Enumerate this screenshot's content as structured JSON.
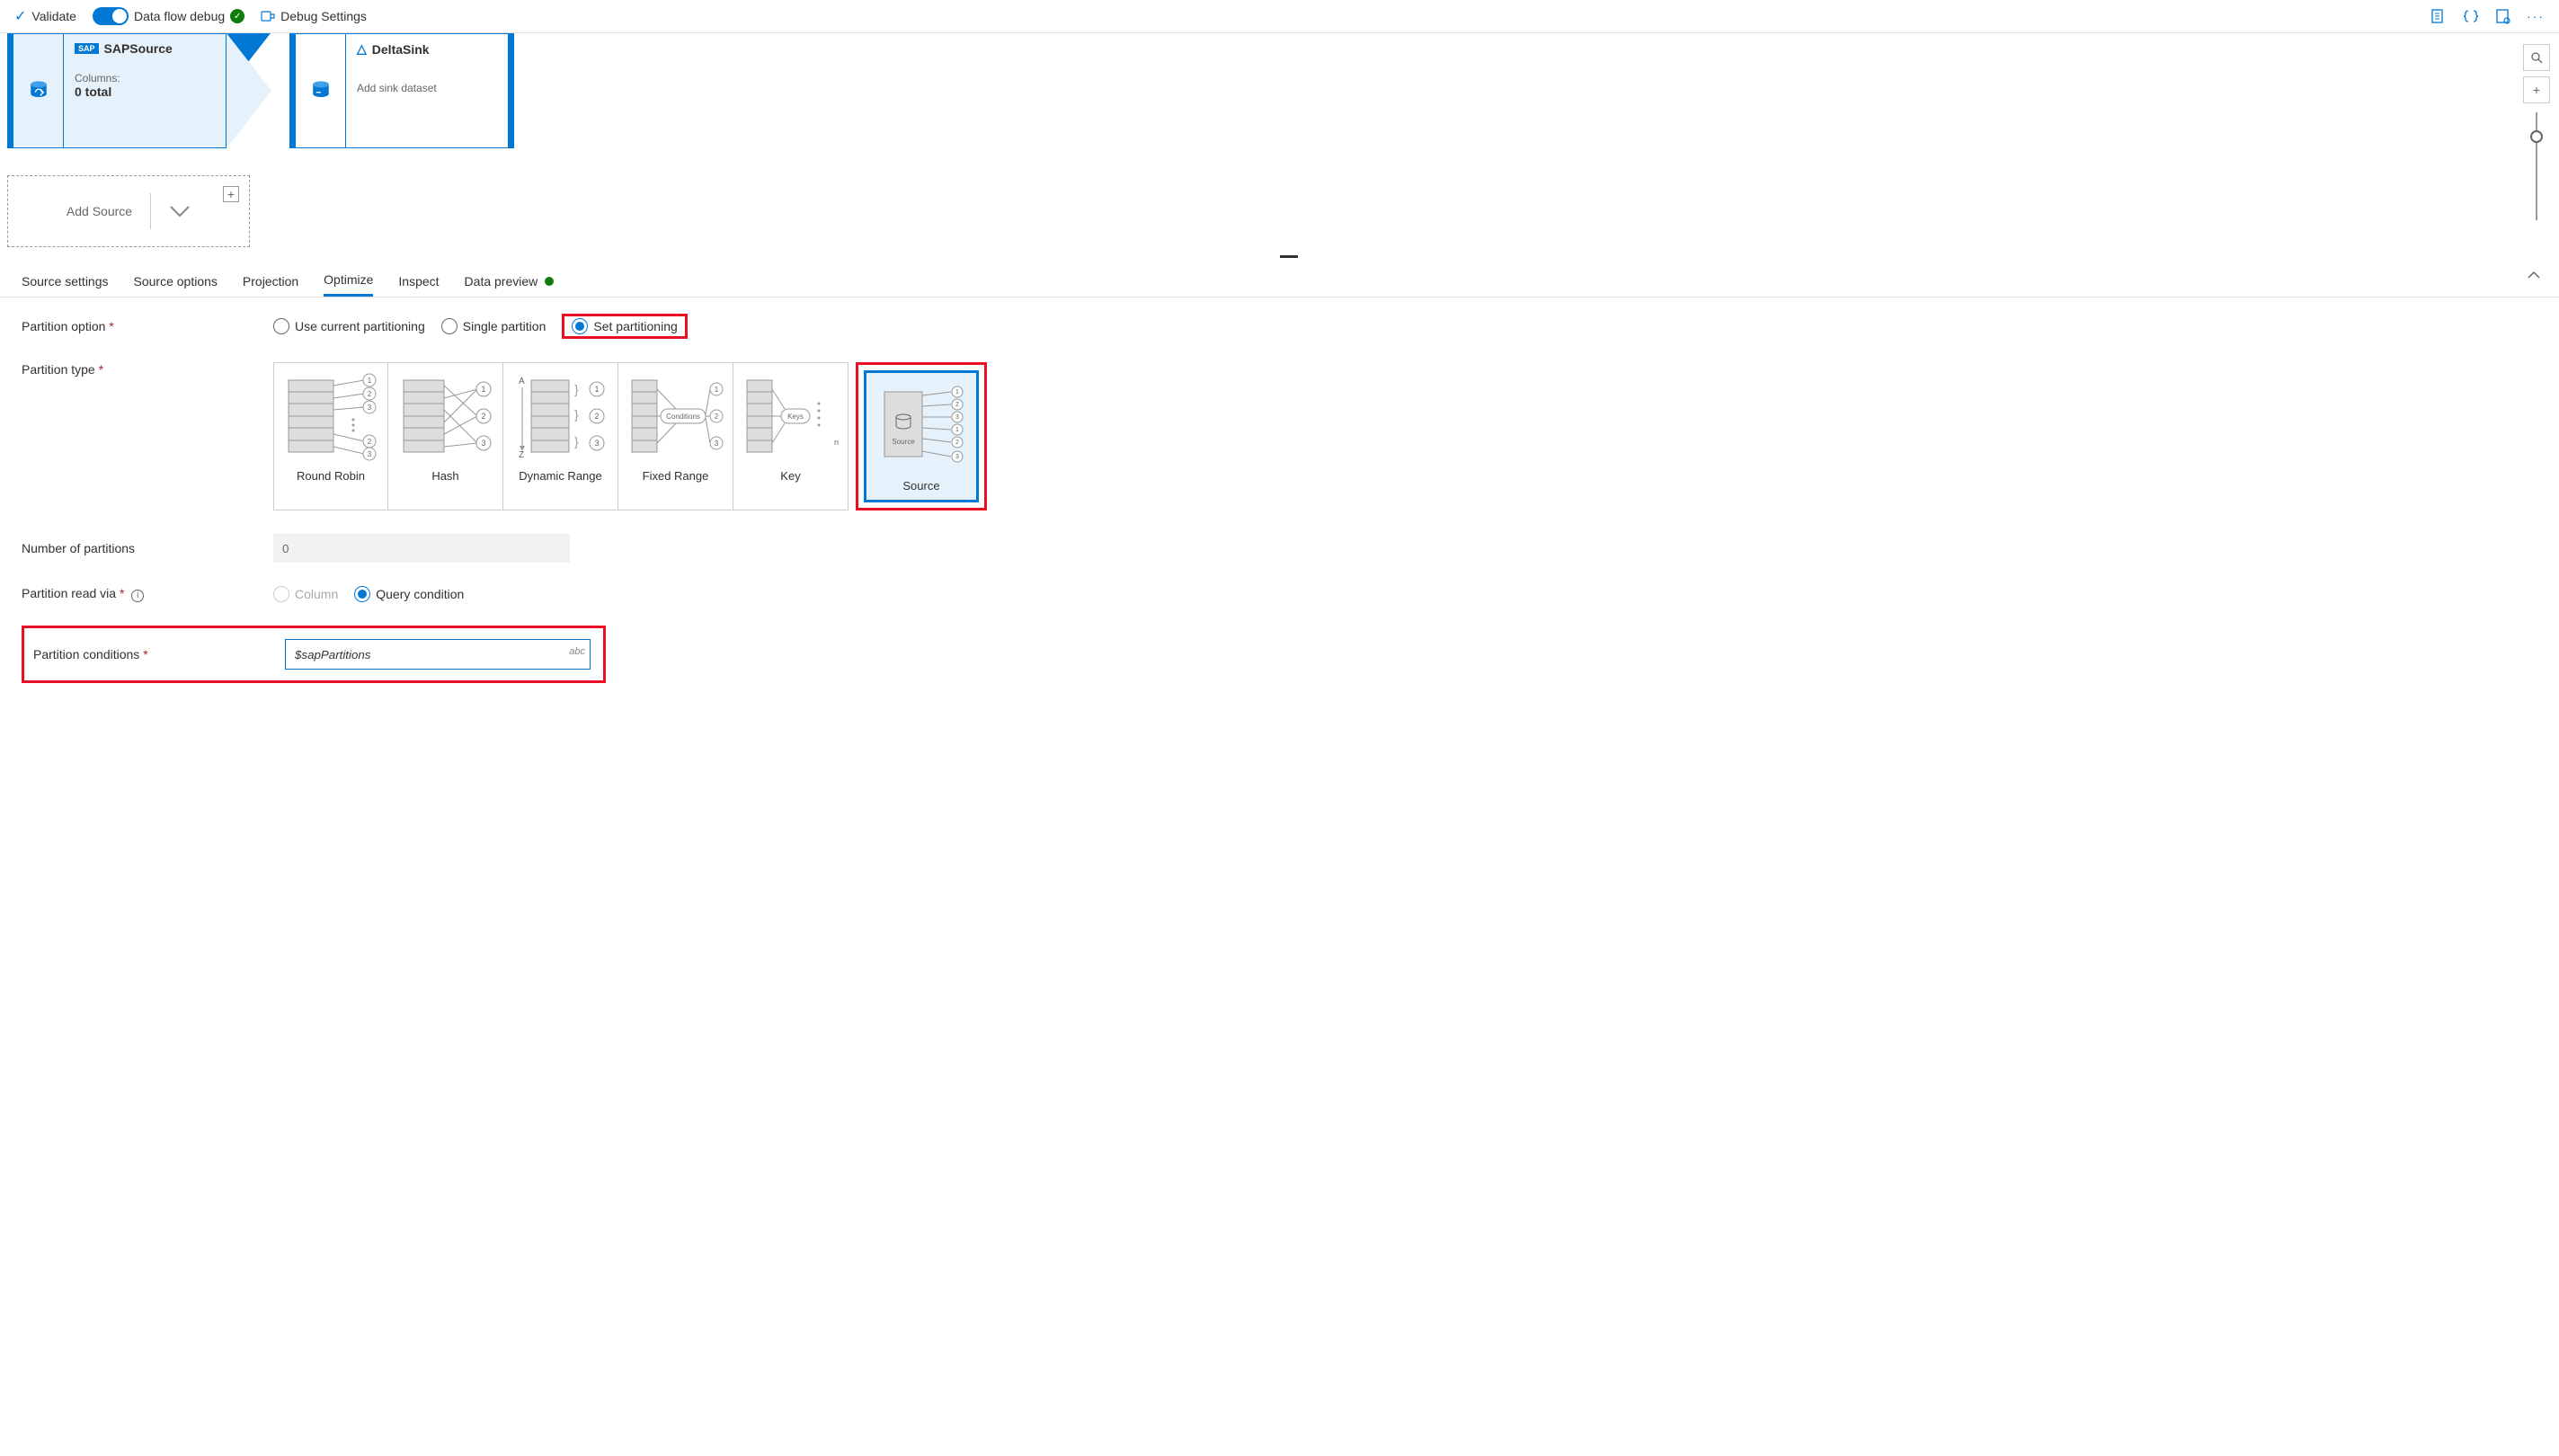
{
  "toolbar": {
    "validate": "Validate",
    "debug_toggle": "Data flow debug",
    "debug_settings": "Debug Settings"
  },
  "canvas": {
    "source": {
      "title": "SAPSource",
      "columns_label": "Columns:",
      "columns_value": "0 total"
    },
    "sink": {
      "title": "DeltaSink",
      "subtitle": "Add sink dataset"
    },
    "add_source": "Add Source"
  },
  "tabs": {
    "t0": "Source settings",
    "t1": "Source options",
    "t2": "Projection",
    "t3": "Optimize",
    "t4": "Inspect",
    "t5": "Data preview"
  },
  "labels": {
    "partition_option": "Partition option",
    "partition_type": "Partition type",
    "num_partitions": "Number of partitions",
    "read_via": "Partition read via",
    "conditions": "Partition conditions"
  },
  "partition_option": {
    "o0": "Use current partitioning",
    "o1": "Single partition",
    "o2": "Set partitioning"
  },
  "partition_types": {
    "p0": "Round Robin",
    "p1": "Hash",
    "p2": "Dynamic Range",
    "p3": "Fixed Range",
    "p4": "Key",
    "p5": "Source"
  },
  "num_partitions_value": "0",
  "read_via": {
    "r0": "Column",
    "r1": "Query condition"
  },
  "conditions_value": "$sapPartitions",
  "abc": "abc"
}
